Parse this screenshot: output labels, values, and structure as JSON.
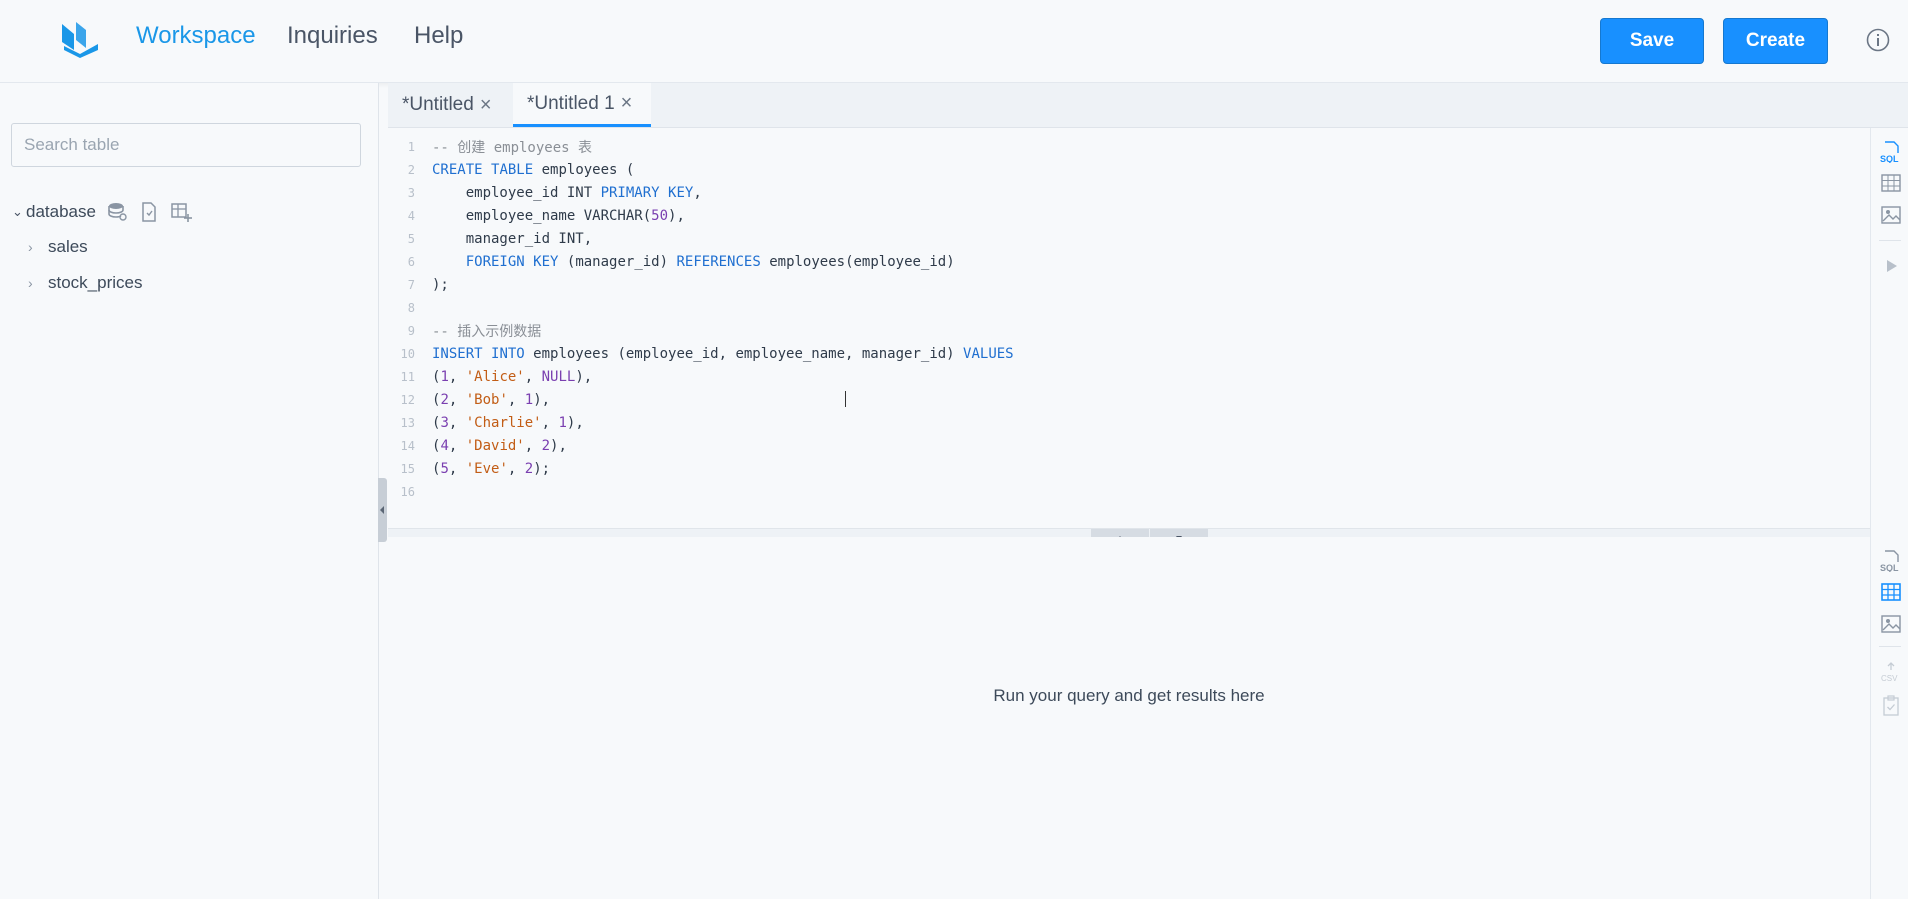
{
  "nav": {
    "workspace": "Workspace",
    "inquiries": "Inquiries",
    "help": "Help"
  },
  "actions": {
    "save": "Save",
    "create": "Create"
  },
  "sidebar": {
    "search_placeholder": "Search table",
    "database_label": "database",
    "tables": [
      "sales",
      "stock_prices"
    ]
  },
  "tabs": [
    {
      "label": "*Untitled",
      "active": false
    },
    {
      "label": "*Untitled 1",
      "active": true
    }
  ],
  "editor": {
    "line_numbers": [
      "1",
      "2",
      "3",
      "4",
      "5",
      "6",
      "7",
      "8",
      "9",
      "10",
      "11",
      "12",
      "13",
      "14",
      "15",
      "16"
    ],
    "lines": [
      "-- 创建 employees 表",
      "CREATE TABLE employees (",
      "    employee_id INT PRIMARY KEY,",
      "    employee_name VARCHAR(50),",
      "    manager_id INT,",
      "    FOREIGN KEY (manager_id) REFERENCES employees(employee_id)",
      ");",
      "",
      "-- 插入示例数据",
      "INSERT INTO employees (employee_id, employee_name, manager_id) VALUES",
      "(1, 'Alice', NULL),",
      "(2, 'Bob', 1),",
      "(3, 'Charlie', 1),",
      "(4, 'David', 2),",
      "(5, 'Eve', 2);",
      ""
    ]
  },
  "results": {
    "empty_message": "Run your query and get results here"
  },
  "colors": {
    "accent": "#1890ff",
    "nav_active": "#1a97e8",
    "keyword": "#1f6fd0",
    "string": "#c25d16",
    "number": "#7a3fb0"
  }
}
